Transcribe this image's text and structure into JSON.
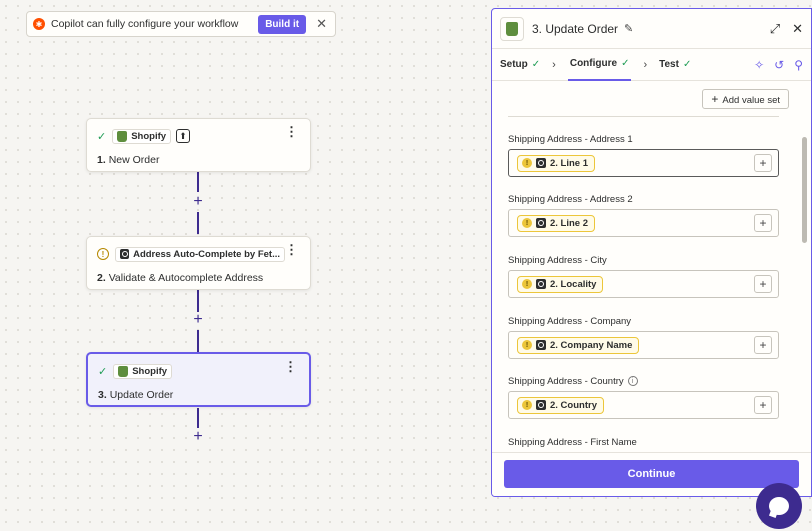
{
  "copilot": {
    "message": "Copilot can fully configure your workflow",
    "build_label": "Build it",
    "close_glyph": "✕"
  },
  "steps": [
    {
      "status": "check",
      "app": "Shopify",
      "title_num": "1.",
      "title": "New Order",
      "selected": false
    },
    {
      "status": "warning",
      "app": "Address Auto-Complete by Fet...",
      "title_num": "2.",
      "title": "Validate & Autocomplete Address",
      "selected": false
    },
    {
      "status": "check",
      "app": "Shopify",
      "title_num": "3.",
      "title": "Update Order",
      "selected": true
    }
  ],
  "panel": {
    "title": "3. Update Order",
    "tabs": [
      {
        "label": "Setup",
        "done": true
      },
      {
        "label": "Configure",
        "done": true,
        "active": true
      },
      {
        "label": "Test",
        "done": true
      }
    ],
    "add_value_label": "Add value set",
    "fields": [
      {
        "label": "Shipping Address - Address 1",
        "value": "2. Line 1",
        "info": false
      },
      {
        "label": "Shipping Address - Address 2",
        "value": "2. Line 2",
        "info": false
      },
      {
        "label": "Shipping Address - City",
        "value": "2. Locality",
        "info": false
      },
      {
        "label": "Shipping Address - Company",
        "value": "2. Company Name",
        "info": false
      },
      {
        "label": "Shipping Address - Country",
        "value": "2. Country",
        "info": true
      },
      {
        "label": "Shipping Address - First Name",
        "value": "",
        "info": false
      }
    ],
    "continue_label": "Continue"
  },
  "colors": {
    "accent": "#695be8",
    "connector": "#3d2b8f",
    "success": "#1f9c55",
    "warning": "#ecc63a",
    "shopify": "#5e8e3e"
  }
}
